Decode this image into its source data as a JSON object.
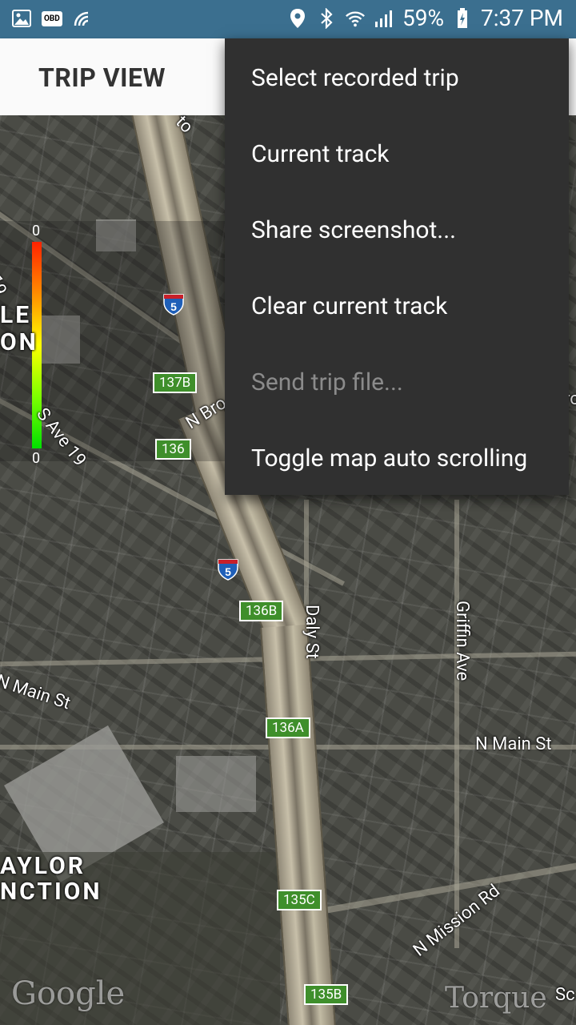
{
  "status_bar": {
    "left_icons": [
      "image-icon",
      "obd-icon",
      "torque-icon"
    ],
    "obd_text": "OBD",
    "battery": "59%",
    "time": "7:37 PM",
    "bg_color": "#3b6f8f"
  },
  "toolbar": {
    "title": "TRIP VIEW"
  },
  "legend": {
    "top_value": "0",
    "bottom_value": "0"
  },
  "map": {
    "street_labels": [
      "S Ave 19",
      "N Bro",
      "Daly St",
      "Griffin Ave",
      "N Main St",
      "N Main St",
      "N Mission Rd",
      "Sc",
      "ro",
      "to",
      "19"
    ],
    "area_labels": [
      "LE",
      "ON",
      "AYLOR",
      "NCTION"
    ],
    "exits": [
      "137B",
      "136",
      "136B",
      "136A",
      "135C",
      "135B"
    ],
    "shields": [
      "5",
      "5"
    ],
    "watermarks": [
      "Google",
      "Torque"
    ]
  },
  "menu": {
    "items": [
      {
        "label": "Select recorded trip",
        "enabled": true
      },
      {
        "label": "Current track",
        "enabled": true
      },
      {
        "label": "Share screenshot...",
        "enabled": true
      },
      {
        "label": "Clear current track",
        "enabled": true
      },
      {
        "label": "Send trip file...",
        "enabled": false
      },
      {
        "label": "Toggle map auto scrolling",
        "enabled": true
      }
    ]
  }
}
